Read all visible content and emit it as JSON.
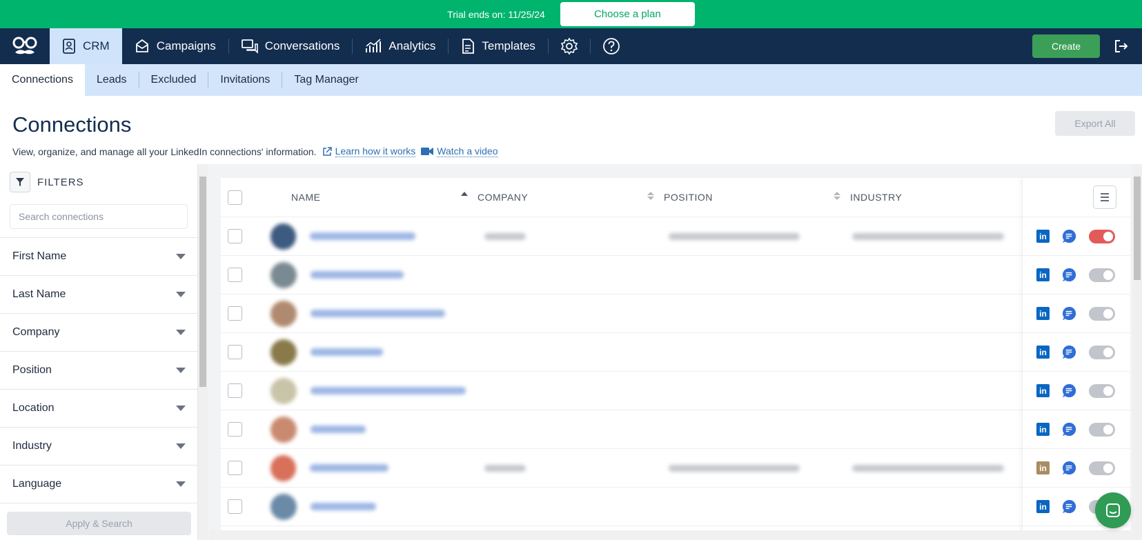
{
  "trial": {
    "text": "Trial ends on: 11/25/24",
    "plan_button": "Choose a plan"
  },
  "nav": {
    "items": [
      {
        "label": "CRM",
        "icon": "contact-card-icon",
        "active": true
      },
      {
        "label": "Campaigns",
        "icon": "envelope-icon"
      },
      {
        "label": "Conversations",
        "icon": "chat-bubbles-icon"
      },
      {
        "label": "Analytics",
        "icon": "bar-chart-icon"
      },
      {
        "label": "Templates",
        "icon": "document-icon"
      }
    ],
    "settings_icon": "gear-icon",
    "help_icon": "question-circle-icon",
    "create_label": "Create",
    "logout_icon": "logout-icon"
  },
  "subnav": {
    "items": [
      {
        "label": "Connections",
        "active": true
      },
      {
        "label": "Leads"
      },
      {
        "label": "Excluded"
      },
      {
        "label": "Invitations"
      },
      {
        "label": "Tag Manager"
      }
    ]
  },
  "header": {
    "title": "Connections",
    "description": "View, organize, and manage all your LinkedIn connections' information.",
    "learn_link": "Learn how it works",
    "video_link": "Watch a video",
    "export_label": "Export All"
  },
  "filters": {
    "title": "FILTERS",
    "search_placeholder": "Search connections",
    "items": [
      "First Name",
      "Last Name",
      "Company",
      "Position",
      "Location",
      "Industry",
      "Language"
    ],
    "apply_label": "Apply & Search"
  },
  "table": {
    "columns": {
      "name": "NAME",
      "company": "COMPANY",
      "position": "POSITION",
      "industry": "INDUSTRY"
    },
    "rows": [
      {
        "linkedin_muted": false,
        "toggle_on": true,
        "has_details": true
      },
      {
        "linkedin_muted": false,
        "toggle_on": false,
        "has_details": false
      },
      {
        "linkedin_muted": false,
        "toggle_on": false,
        "has_details": false
      },
      {
        "linkedin_muted": false,
        "toggle_on": false,
        "has_details": false
      },
      {
        "linkedin_muted": false,
        "toggle_on": false,
        "has_details": false
      },
      {
        "linkedin_muted": false,
        "toggle_on": false,
        "has_details": false
      },
      {
        "linkedin_muted": true,
        "toggle_on": false,
        "has_details": true
      },
      {
        "linkedin_muted": false,
        "toggle_on": false,
        "has_details": false
      }
    ]
  },
  "colors": {
    "banner": "#00b46e",
    "nav": "#132d4f",
    "subnav": "#d3e5fb",
    "create": "#3c9f58",
    "linkedin": "#0a66c2",
    "message": "#2f6ed6",
    "toggle_on": "#e35a5a",
    "chat": "#2f9b55"
  },
  "chat_icon": "chat-widget-icon"
}
